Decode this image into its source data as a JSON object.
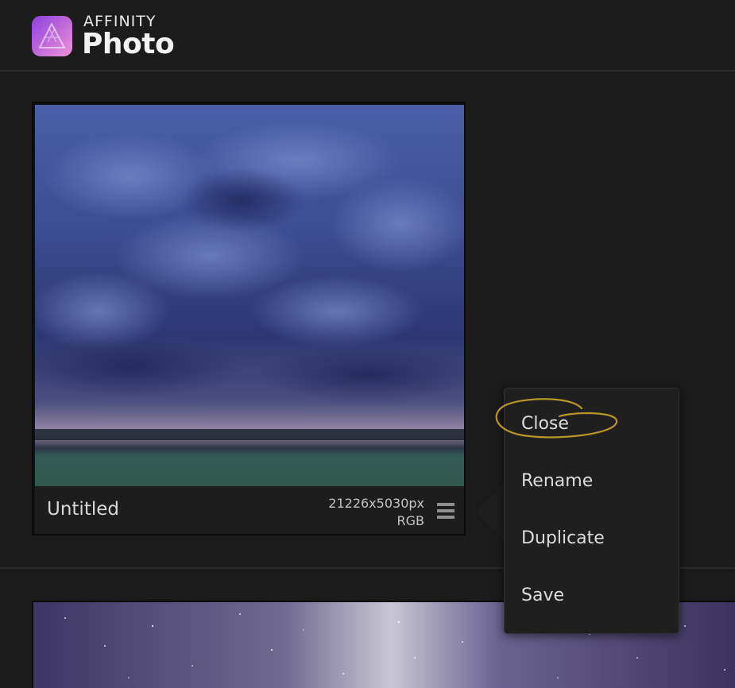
{
  "app": {
    "brand_line1": "AFFINITY",
    "brand_line2": "Photo",
    "icon": "affinity-photo-logo"
  },
  "documents": [
    {
      "title": "Untitled",
      "dimensions": "21226x5030px",
      "color_mode": "RGB",
      "thumbnail": "stormy-sky-over-sea",
      "menu_icon": "hamburger-menu-icon"
    },
    {
      "thumbnail": "milky-way-night-sky"
    }
  ],
  "context_menu": {
    "items": [
      {
        "label": "Close"
      },
      {
        "label": "Rename"
      },
      {
        "label": "Duplicate"
      },
      {
        "label": "Save"
      }
    ],
    "highlight_color": "#b8962a"
  },
  "colors": {
    "background": "#1b1b1b",
    "logo_gradient_start": "#a24be0",
    "logo_gradient_end": "#e38ad4"
  }
}
